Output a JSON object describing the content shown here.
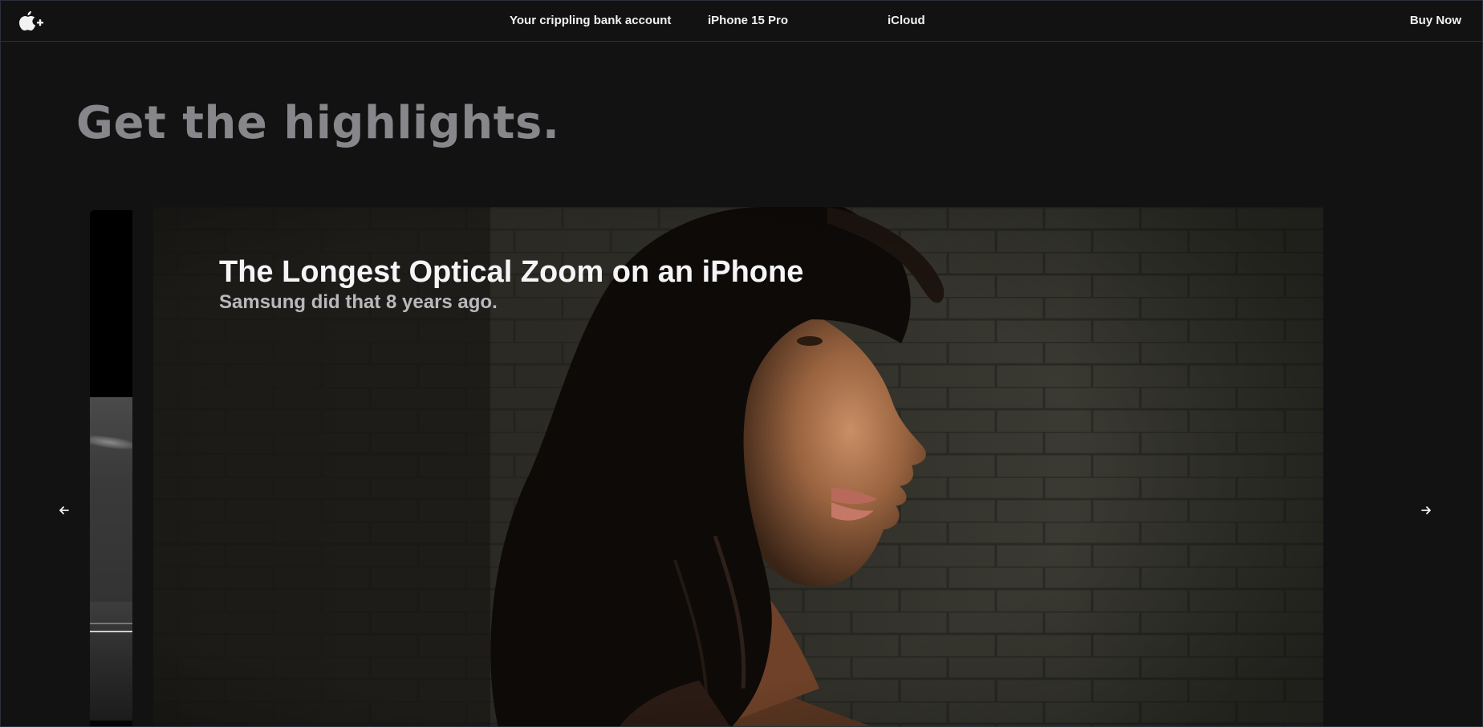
{
  "nav": {
    "logo_icon": "apple-plus-logo-icon",
    "links": [
      {
        "label": "Your crippling bank account"
      },
      {
        "label": "iPhone 15 Pro"
      },
      {
        "label": "iCloud"
      }
    ],
    "buy_label": "Buy Now"
  },
  "highlights": {
    "heading": "Get the highlights."
  },
  "carousel": {
    "active_slide": {
      "title": "The Longest Optical Zoom on an iPhone",
      "subtitle": "Samsung did that 8 years ago.",
      "image_subject": "woman-profile-photo"
    },
    "previous_slide": {
      "image_subject": "partial-previous-slide"
    },
    "prev_icon": "arrow-left-icon",
    "next_icon": "arrow-right-icon"
  },
  "colors": {
    "background": "#121212",
    "nav_text": "#f2f2f2",
    "heading": "#86868b",
    "card_title": "#f5f5f7",
    "card_subtitle": "#b9b9bd"
  }
}
